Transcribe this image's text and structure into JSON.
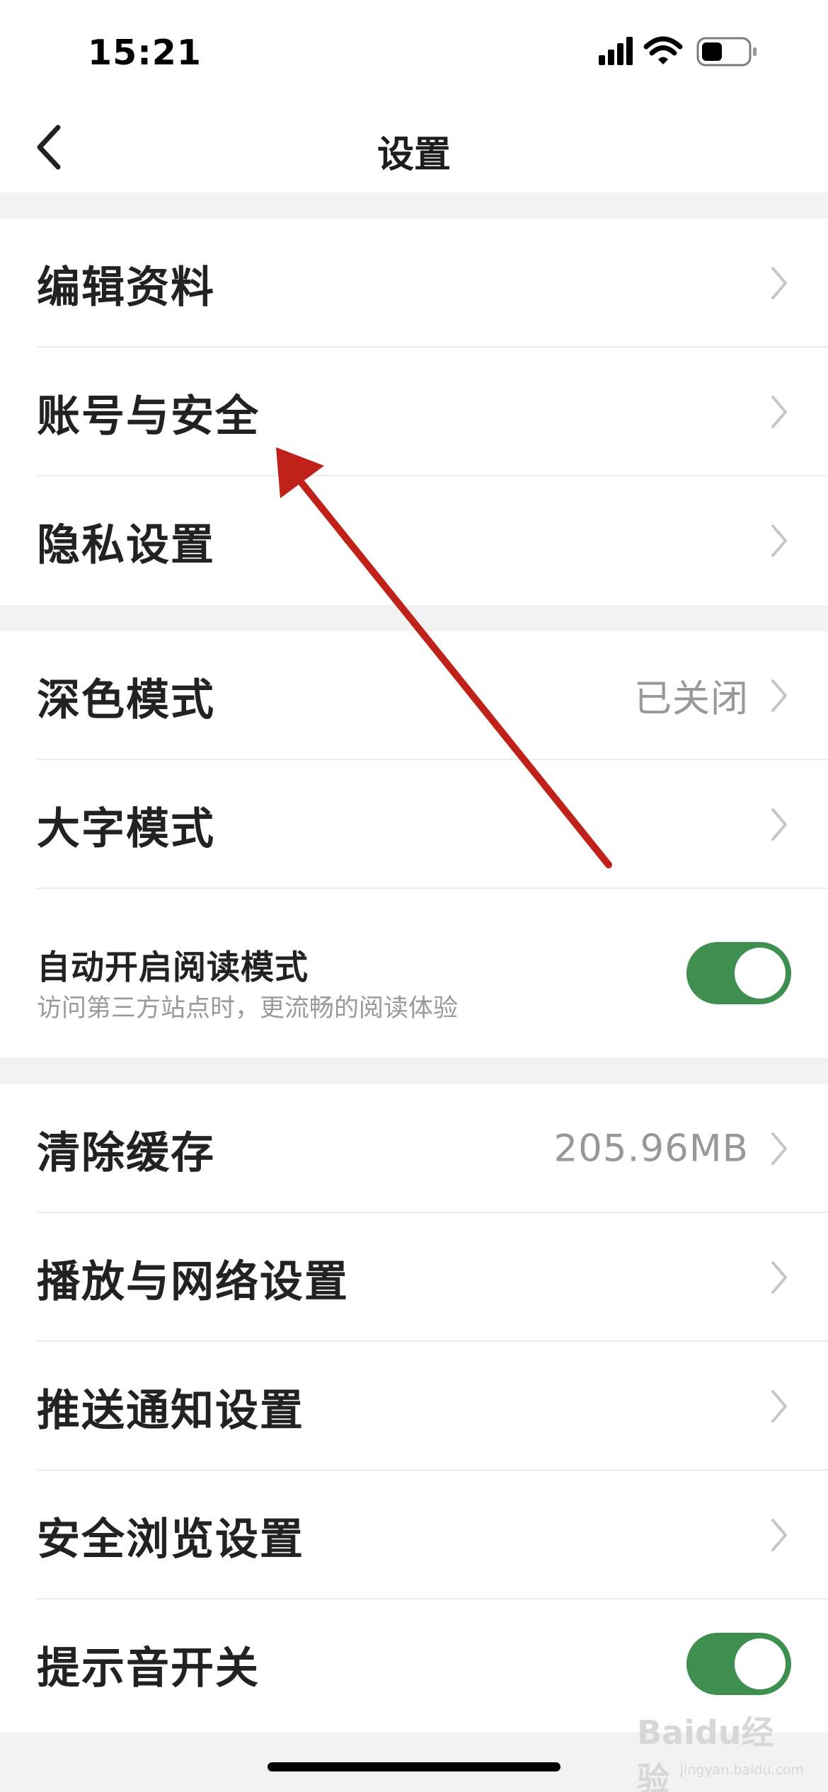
{
  "status_bar": {
    "time": "15:21"
  },
  "header": {
    "title": "设置"
  },
  "groups": [
    {
      "items": [
        {
          "label": "编辑资料"
        },
        {
          "label": "账号与安全"
        },
        {
          "label": "隐私设置"
        }
      ]
    },
    {
      "items": [
        {
          "label": "深色模式",
          "value": "已关闭"
        },
        {
          "label": "大字模式"
        },
        {
          "label": "自动开启阅读模式",
          "subtitle": "访问第三方站点时，更流畅的阅读体验",
          "toggle": true
        }
      ]
    },
    {
      "items": [
        {
          "label": "清除缓存",
          "value": "205.96MB"
        },
        {
          "label": "播放与网络设置"
        },
        {
          "label": "推送通知设置"
        },
        {
          "label": "安全浏览设置"
        },
        {
          "label": "提示音开关",
          "toggle": true
        }
      ]
    }
  ],
  "watermark": {
    "brand": "Baidu经验",
    "url": "jingyan.baidu.com"
  },
  "colors": {
    "accent_toggle": "#3f8f50",
    "annotation_arrow": "#c0221a",
    "secondary_text": "#989898"
  },
  "icons": {
    "back": "chevron-left-icon",
    "row_chevron": "chevron-right-icon",
    "signal": "cellular-signal-icon",
    "wifi": "wifi-icon",
    "battery": "battery-icon"
  }
}
